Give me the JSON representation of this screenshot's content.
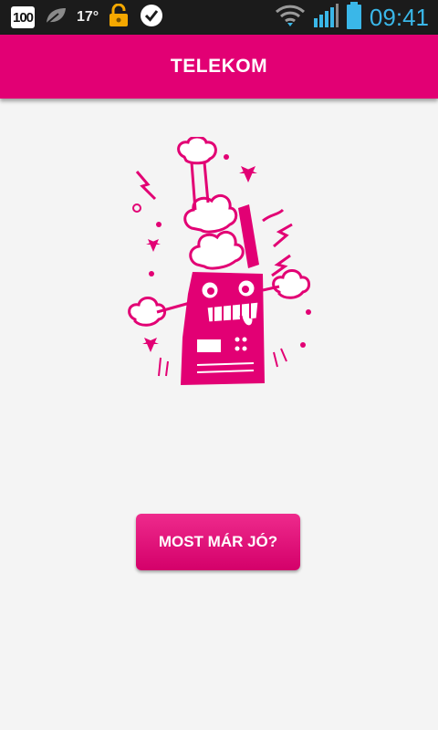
{
  "status_bar": {
    "battery_badge": "100",
    "temperature": "17°",
    "time": "09:41",
    "icons": [
      "battery-100-icon",
      "leaf-icon",
      "unlocked-padlock-icon",
      "check-badge-icon",
      "wifi-icon",
      "signal-bars-icon",
      "battery-icon"
    ]
  },
  "app_bar": {
    "title": "TELEKOM"
  },
  "main": {
    "illustration": "exploding-phone-illustration",
    "retry_button_label": "MOST MÁR JÓ?"
  },
  "colors": {
    "brand": "#e20074",
    "status_bar": "#1b1b1b",
    "clock": "#3ab7e8",
    "background": "#f4f4f4"
  }
}
